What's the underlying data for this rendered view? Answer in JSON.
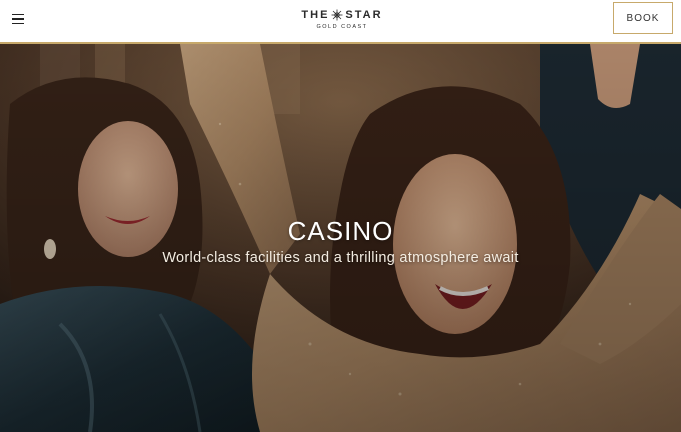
{
  "header": {
    "menu_icon": "hamburger-menu-icon",
    "logo_main_left": "THE",
    "logo_main_right": "STAR",
    "logo_sub": "GOLD COAST",
    "logo_icon": "star-emblem-icon",
    "book_label": "BOOK",
    "accent_color": "#c7a96b"
  },
  "hero": {
    "title": "CASINO",
    "subtitle": "World-class facilities and a thrilling atmosphere await"
  }
}
